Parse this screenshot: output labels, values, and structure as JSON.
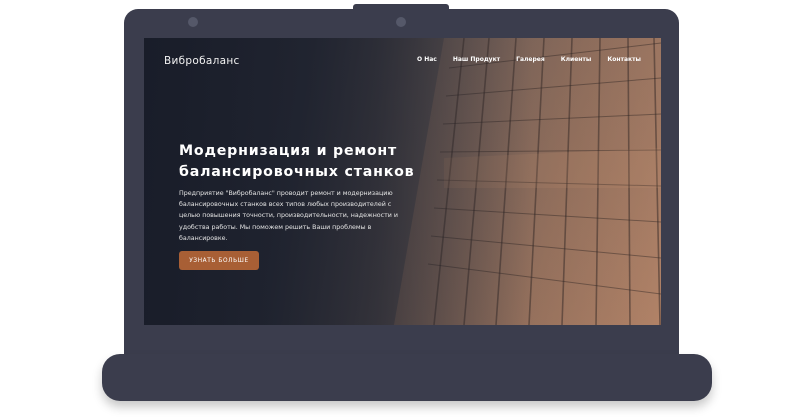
{
  "site": {
    "logo": "Вибробаланс",
    "nav": [
      "О Нас",
      "Наш Продукт",
      "Галерея",
      "Клиенты",
      "Контакты"
    ]
  },
  "hero": {
    "title_line1": "Модернизация и ремонт",
    "title_line2": "балансировочных станков",
    "description": "Предприятие \"Вибробаланс\" проводит ремонт и модернизацию балансировочных станков всех типов любых производителей с целью повышения точности, производительности, надежности и удобства работы. Мы поможем решить Ваши проблемы в балансировке.",
    "button_label": "УЗНАТЬ БОЛЬШЕ"
  },
  "colors": {
    "laptop_frame": "#3b3d4d",
    "accent_button": "#a85f35",
    "page_background": "#ffffff"
  }
}
